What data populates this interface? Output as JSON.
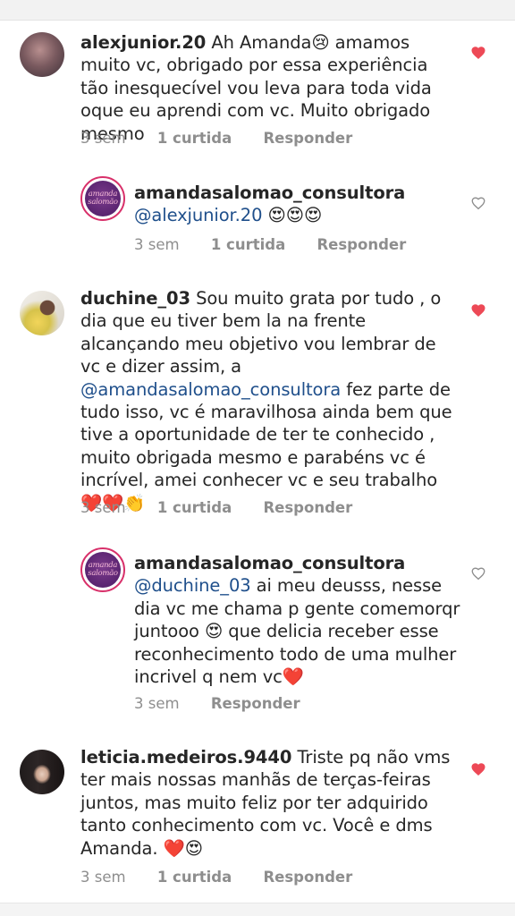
{
  "comments": [
    {
      "username": "alexjunior.20",
      "text": "Ah Amanda😢 amamos muito vc, obrigado por essa experiência tão inesquecível vou leva para toda vida oque eu aprendi com vc. Muito obrigado mesmo",
      "time": "3 sem",
      "likes": "1 curtida",
      "reply": "Responder",
      "liked": true
    },
    {
      "username": "amandasalomao_consultora",
      "mention": "@alexjunior.20",
      "text": " 😍😍😍",
      "time": "3 sem",
      "likes": "1 curtida",
      "reply": "Responder",
      "liked": false,
      "logo_text": "amanda salomão"
    },
    {
      "username": "duchine_03",
      "text_before": "Sou muito grata por tudo , o dia que eu tiver bem la na frente alcançando meu objetivo vou lembrar de vc e dizer assim, a ",
      "mention": "@amandasalomao_consultora",
      "text_after": " fez parte de tudo isso,  vc é maravilhosa ainda bem que tive a oportunidade de ter te conhecido , muito obrigada mesmo e parabéns vc é incrível,  amei conhecer vc e seu trabalho ❤️❤️👏",
      "time": "3 sem",
      "likes": "1 curtida",
      "reply": "Responder",
      "liked": true
    },
    {
      "username": "amandasalomao_consultora",
      "mention": "@duchine_03",
      "text": " ai meu deusss, nesse dia vc me chama p gente comemorqr juntooo 😍 que delicia receber esse reconhecimento todo de uma mulher incrivel q nem vc❤️",
      "time": "3 sem",
      "reply": "Responder",
      "liked": false,
      "logo_text": "amanda salomão"
    },
    {
      "username": "leticia.medeiros.9440",
      "text": "Triste pq não vms ter mais nossas manhãs de terças-feiras juntos, mas muito feliz por ter adquirido tanto conhecimento com vc. Você e dms Amanda. ❤️😍",
      "time": "3 sem",
      "likes": "1 curtida",
      "reply": "Responder",
      "liked": true
    }
  ],
  "colors": {
    "text": "#262626",
    "meta": "#8e8e8e",
    "mention": "#1f4f8b",
    "heart_liked": "#ed4956",
    "heart_outline": "#8e8e8e"
  },
  "icons": {
    "like": "heart-icon"
  }
}
